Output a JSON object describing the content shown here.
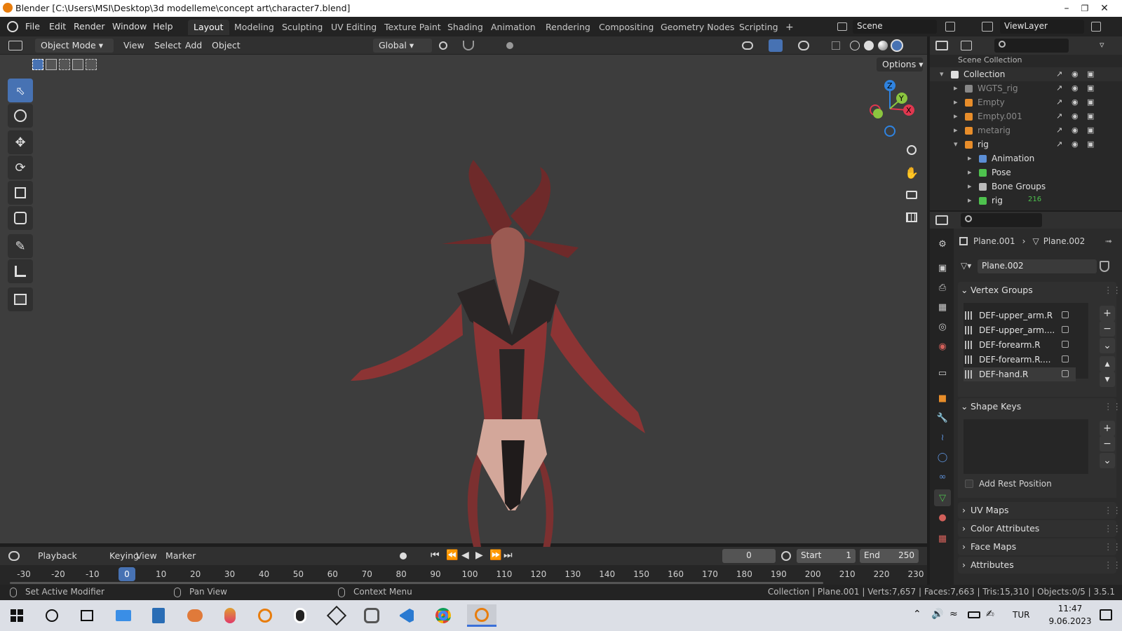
{
  "window": {
    "title": "Blender [C:\\Users\\MSI\\Desktop\\3d modelleme\\concept art\\character7.blend]"
  },
  "menu": {
    "file": "File",
    "edit": "Edit",
    "render": "Render",
    "window": "Window",
    "help": "Help"
  },
  "workspaces": [
    "Layout",
    "Modeling",
    "Sculpting",
    "UV Editing",
    "Texture Paint",
    "Shading",
    "Animation",
    "Rendering",
    "Compositing",
    "Geometry Nodes",
    "Scripting"
  ],
  "active_workspace": "Layout",
  "scene": {
    "name": "Scene",
    "view_layer": "ViewLayer"
  },
  "viewport": {
    "mode": "Object Mode",
    "menus": {
      "view": "View",
      "select": "Select",
      "add": "Add",
      "object": "Object"
    },
    "orientation": "Global",
    "options": "Options",
    "gizmo_labels": {
      "z": "Z",
      "y": "Y",
      "x": "X"
    }
  },
  "outliner": {
    "header": "Scene Collection",
    "items": [
      {
        "label": "Collection"
      },
      {
        "label": "WGTS_rig"
      },
      {
        "label": "Empty"
      },
      {
        "label": "Empty.001"
      },
      {
        "label": "metarig"
      },
      {
        "label": "rig"
      },
      {
        "label": "Animation"
      },
      {
        "label": "Pose"
      },
      {
        "label": "Bone Groups"
      },
      {
        "label": "rig",
        "badge": "216"
      }
    ]
  },
  "properties": {
    "breadcrumb": {
      "object": "Plane.001",
      "data": "Plane.002"
    },
    "mesh_name": "Plane.002",
    "vertex_groups": {
      "title": "Vertex Groups",
      "items": [
        "DEF-upper_arm.R",
        "DEF-upper_arm....",
        "DEF-forearm.R",
        "DEF-forearm.R....",
        "DEF-hand.R"
      ]
    },
    "shape_keys": {
      "title": "Shape Keys"
    },
    "add_rest_position": "Add Rest Position",
    "uv_maps": "UV Maps",
    "color_attributes": "Color Attributes",
    "face_maps": "Face Maps",
    "attributes": "Attributes"
  },
  "timeline": {
    "menus": {
      "playback": "Playback",
      "keying": "Keying",
      "view": "View",
      "marker": "Marker"
    },
    "current_frame": "0",
    "start_label": "Start",
    "start": "1",
    "end_label": "End",
    "end": "250",
    "ticks": [
      "-30",
      "-20",
      "-10",
      "0",
      "10",
      "20",
      "30",
      "40",
      "50",
      "60",
      "70",
      "80",
      "90",
      "100",
      "110",
      "120",
      "130",
      "140",
      "150",
      "160",
      "170",
      "180",
      "190",
      "200",
      "210",
      "220",
      "230"
    ]
  },
  "statusbar": {
    "left1": "Set Active Modifier",
    "left2": "Pan View",
    "left3": "Context Menu",
    "right": "Collection | Plane.001 | Verts:7,657 | Faces:7,663 | Tris:15,310 | Objects:0/5 | 3.5.1"
  },
  "taskbar": {
    "language": "TUR",
    "time": "11:47",
    "date": "9.06.2023"
  },
  "colors": {
    "accent": "#4772b3",
    "active_frame": "#4772b3",
    "gizmo_x": "#e0374f",
    "gizmo_y": "#8bc53f",
    "gizmo_z": "#2f83e0",
    "creature_skin": "#8c3434",
    "creature_armor": "#2a2626"
  }
}
